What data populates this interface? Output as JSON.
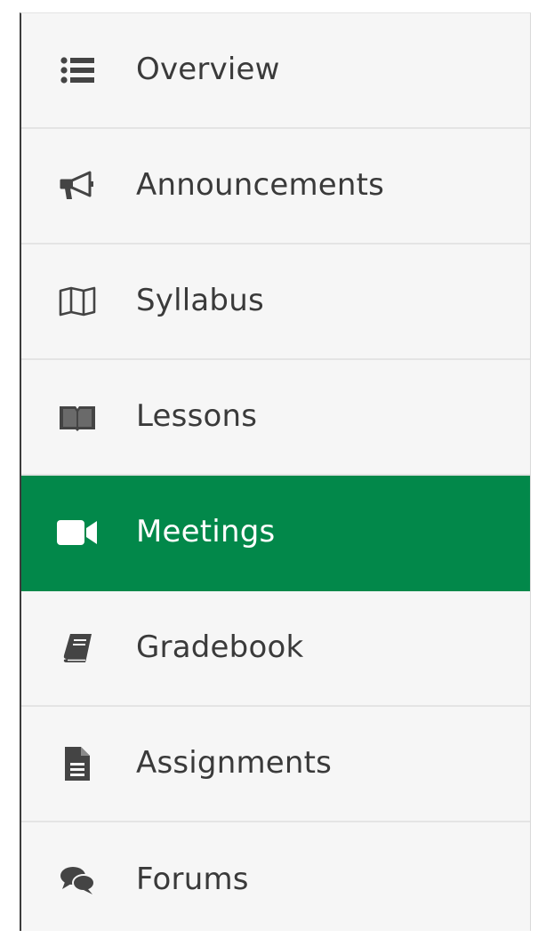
{
  "nav": {
    "active_index": 4,
    "colors": {
      "active_bg": "#02884a",
      "text": "#3a3a3a",
      "active_text": "#ffffff",
      "icon": "#444444"
    },
    "items": [
      {
        "label": "Overview",
        "icon": "list-icon"
      },
      {
        "label": "Announcements",
        "icon": "megaphone-icon"
      },
      {
        "label": "Syllabus",
        "icon": "map-icon"
      },
      {
        "label": "Lessons",
        "icon": "open-book-icon"
      },
      {
        "label": "Meetings",
        "icon": "video-camera-icon"
      },
      {
        "label": "Gradebook",
        "icon": "book-icon"
      },
      {
        "label": "Assignments",
        "icon": "document-icon"
      },
      {
        "label": "Forums",
        "icon": "comments-icon"
      }
    ]
  }
}
